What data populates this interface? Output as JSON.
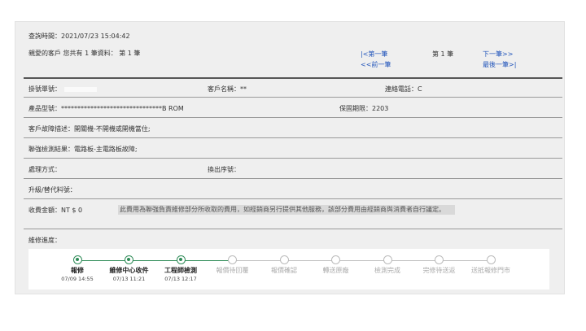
{
  "query": {
    "label": "查詢時間：",
    "value": "2021/07/23 15:04:42"
  },
  "customer_notice": "親愛的客戶 您共有 1 筆資料： 第 1 筆",
  "pager": {
    "first": "|<第一筆",
    "prev": "<<前一筆",
    "current": "第 1 筆",
    "next": "下一筆>>",
    "last": "最後一筆>|"
  },
  "fields": {
    "ticket_label": "掛號單號：",
    "customer_label": "客戶名稱：",
    "customer_value": "**",
    "phone_label": "連絡電話：",
    "phone_value": "C",
    "model_label": "產品型號：",
    "model_value": "*******************************B ROM",
    "warranty_label": "保固期限：",
    "warranty_value": "2203",
    "fault_label": "客戶故障描述：",
    "fault_value": "開關機-不開機或開機當住;",
    "inspect_label": "聯強檢測結果：",
    "inspect_value": "電路板-主電路板故障;",
    "method_label": "處理方式：",
    "serial_label": "換出序號：",
    "upgrade_label": "升級/替代料號：",
    "fee_label": "收費金額：",
    "fee_value": "NT $ 0",
    "fee_note": "此費用為聯強負責維修部分所收取的費用，如經銷商另行提供其他服務，該部分費用由經銷商與消費者自行議定。",
    "progress_label": "維修進度："
  },
  "progress": [
    {
      "label": "報修",
      "time": "07/09 14:55",
      "done": true
    },
    {
      "label": "維修中心收件",
      "time": "07/13 11:21",
      "done": true
    },
    {
      "label": "工程師檢測",
      "time": "07/13 12:17",
      "done": true
    },
    {
      "label": "報價待回覆",
      "time": "",
      "done": false
    },
    {
      "label": "報價確認",
      "time": "",
      "done": false
    },
    {
      "label": "轉送原廠",
      "time": "",
      "done": false
    },
    {
      "label": "檢測完成",
      "time": "",
      "done": false
    },
    {
      "label": "完修待送返",
      "time": "",
      "done": false
    },
    {
      "label": "送抵報修門市",
      "time": "",
      "done": false
    }
  ],
  "colors": {
    "done": "#2e8b57",
    "pending": "#bfbfbf",
    "link": "#2255bb"
  }
}
